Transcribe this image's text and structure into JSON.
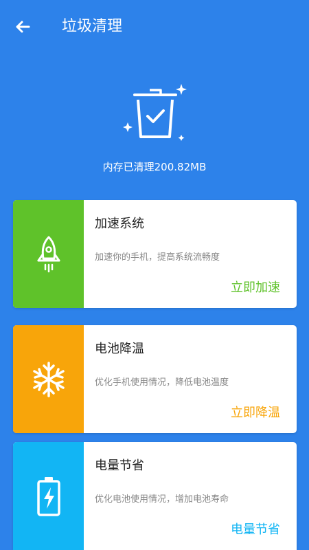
{
  "header": {
    "title": "垃圾清理"
  },
  "hero": {
    "status_text": "内存已清理200.82MB"
  },
  "cards": [
    {
      "title": "加速系统",
      "desc": "加速你的手机，提高系统流畅度",
      "action": "立即加速",
      "icon": "rocket-icon",
      "color": "#5FC22A"
    },
    {
      "title": "电池降温",
      "desc": "优化手机使用情况，降低电池温度",
      "action": "立即降温",
      "icon": "snowflake-icon",
      "color": "#F8A50A"
    },
    {
      "title": "电量节省",
      "desc": "优化电池使用情况，增加电池寿命",
      "action": "电量节省",
      "icon": "battery-icon",
      "color": "#12B5F4"
    }
  ]
}
